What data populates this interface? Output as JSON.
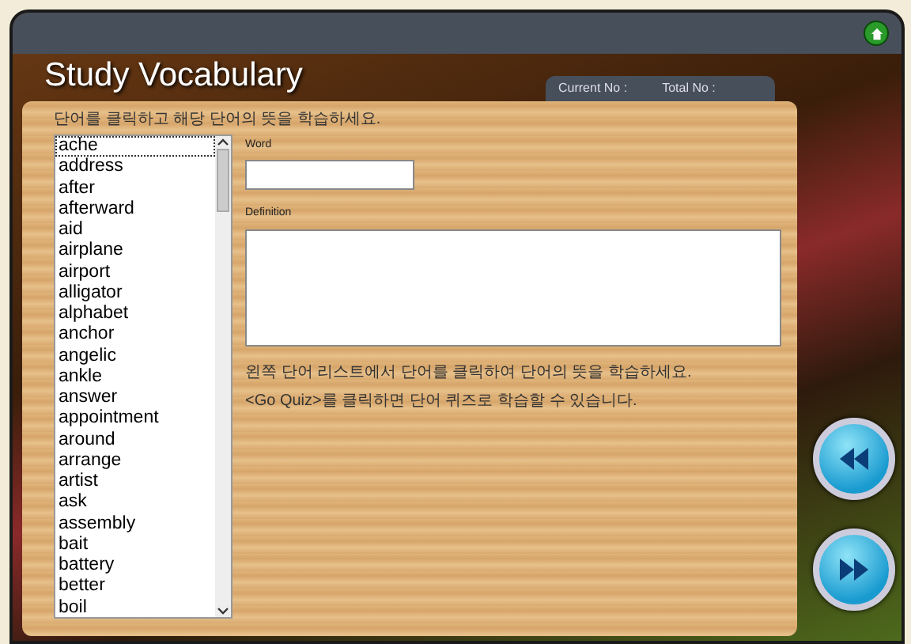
{
  "header": {
    "title": "Study Vocabulary",
    "current_label": "Current No :",
    "total_label": "Total No :"
  },
  "instruction": "단어를 클릭하고 해당 단어의 뜻을 학습하세요.",
  "word_list": [
    {
      "word": "ache",
      "selected": true
    },
    {
      "word": "address",
      "selected": false
    },
    {
      "word": "after",
      "selected": false
    },
    {
      "word": "afterward",
      "selected": false
    },
    {
      "word": "aid",
      "selected": false
    },
    {
      "word": "airplane",
      "selected": false
    },
    {
      "word": "airport",
      "selected": false
    },
    {
      "word": "alligator",
      "selected": false
    },
    {
      "word": "alphabet",
      "selected": false
    },
    {
      "word": "anchor",
      "selected": false
    },
    {
      "word": "angelic",
      "selected": false
    },
    {
      "word": "ankle",
      "selected": false
    },
    {
      "word": "answer",
      "selected": false
    },
    {
      "word": "appointment",
      "selected": false
    },
    {
      "word": "around",
      "selected": false
    },
    {
      "word": "arrange",
      "selected": false
    },
    {
      "word": "artist",
      "selected": false
    },
    {
      "word": "ask",
      "selected": false
    },
    {
      "word": "assembly",
      "selected": false
    },
    {
      "word": "bait",
      "selected": false
    },
    {
      "word": "battery",
      "selected": false
    },
    {
      "word": "better",
      "selected": false
    },
    {
      "word": "boil",
      "selected": false
    }
  ],
  "word_field": {
    "label": "Word"
  },
  "definition_field": {
    "label": "Definition"
  },
  "hints": [
    "왼쪽 단어 리스트에서 단어를 클릭하여 단어의 뜻을 학습하세요.",
    "<Go Quiz>를 클릭하면 단어 퀴즈로 학습할 수 있습니다."
  ]
}
